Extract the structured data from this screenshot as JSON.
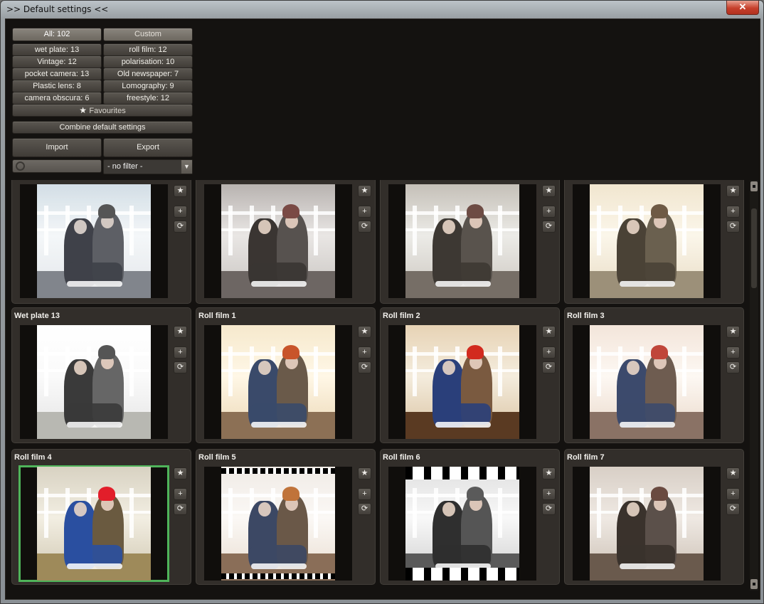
{
  "window": {
    "title": ">> Default settings <<",
    "close_label": "✕"
  },
  "controls": {
    "all": "All: 102",
    "custom": "Custom",
    "categories": [
      "wet plate: 13",
      "roll film: 12",
      "Vintage: 12",
      "polarisation: 10",
      "pocket camera: 13",
      "Old newspaper: 7",
      "Plastic lens: 8",
      "Lomography: 9",
      "camera obscura: 6",
      "freestyle: 12"
    ],
    "favourites": "Favourites",
    "combine": "Combine default settings",
    "import": "Import",
    "export": "Export",
    "search_placeholder": "",
    "filter_value": "- no filter -"
  },
  "actions": {
    "favourite_glyph": "★",
    "add_glyph": "+",
    "reset_glyph": "⟳"
  },
  "presets": [
    {
      "title": "",
      "tone": "cool",
      "selected": false
    },
    {
      "title": "",
      "tone": "grey",
      "selected": false
    },
    {
      "title": "",
      "tone": "grey-warm",
      "selected": false
    },
    {
      "title": "",
      "tone": "cream",
      "selected": false
    },
    {
      "title": "Wet plate 13",
      "tone": "bright-bw",
      "selected": false
    },
    {
      "title": "Roll film 1",
      "tone": "warm-light",
      "selected": false
    },
    {
      "title": "Roll film 2",
      "tone": "color-vivid",
      "selected": false
    },
    {
      "title": "Roll film 3",
      "tone": "warm-pale",
      "selected": false
    },
    {
      "title": "Roll film 4",
      "tone": "color-saturated",
      "selected": true
    },
    {
      "title": "Roll film 5",
      "tone": "perforated",
      "selected": false
    },
    {
      "title": "Roll film 6",
      "tone": "bw-film-strip",
      "selected": false
    },
    {
      "title": "Roll film 7",
      "tone": "sepia",
      "selected": false
    }
  ],
  "colors": {
    "selection": "#4fb45a",
    "background": "#141210",
    "card": "#322e2a"
  }
}
